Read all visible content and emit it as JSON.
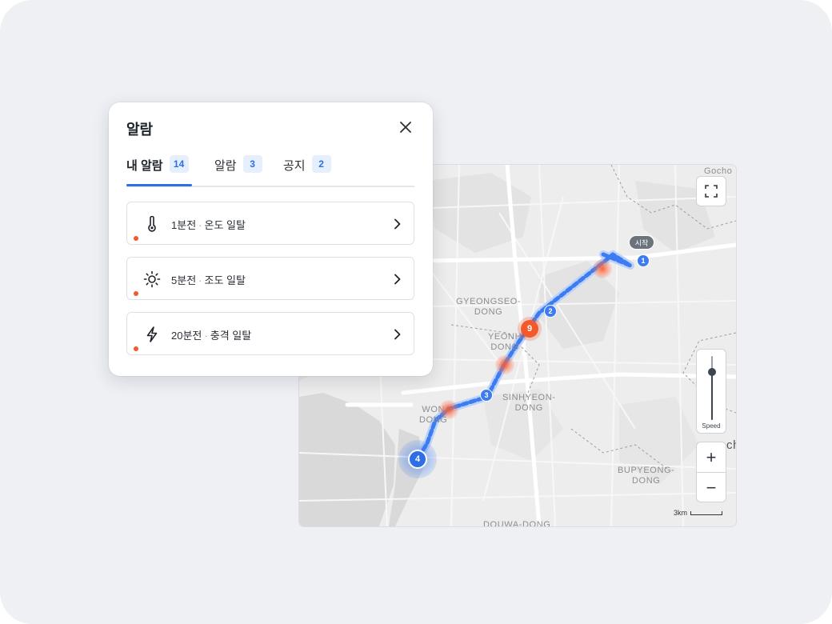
{
  "panel": {
    "title": "알람",
    "tabs": [
      {
        "label": "내 알람",
        "count": "14"
      },
      {
        "label": "알람",
        "count": "3"
      },
      {
        "label": "공지",
        "count": "2"
      }
    ],
    "items": [
      {
        "time": "1분전",
        "separator": "·",
        "text": "온도 일탈",
        "icon": "thermometer-icon"
      },
      {
        "time": "5분전",
        "separator": "·",
        "text": "조도 일탈",
        "icon": "sun-icon"
      },
      {
        "time": "20분전",
        "separator": "·",
        "text": "충격 일탈",
        "icon": "lightning-icon"
      }
    ]
  },
  "map": {
    "labels": {
      "gocho": "Gocho",
      "gyeongseo": "GYEONGSEO-\nDONG",
      "yeonhui": "YEONH\nDONG",
      "sinhyeon": "SINHYEON-\nDONG",
      "wonhyeon": "WON\nDONG",
      "bupyeong": "BUPYEONG-\nDONG",
      "douwa": "DOUWA-DONG",
      "edge": "ch"
    },
    "start_label": "시작",
    "waypoints": [
      "1",
      "2",
      "3"
    ],
    "cluster_count": "9",
    "current_position": "4",
    "speed_label": "Speed",
    "speed_level": 0.75,
    "zoom_in_label": "+",
    "zoom_out_label": "−",
    "scale_label": "3km",
    "colors": {
      "route": "#3d7cf0",
      "alarm": "#f3592a",
      "badge_bg": "#e6effc",
      "accent": "#2f6fe6"
    }
  }
}
